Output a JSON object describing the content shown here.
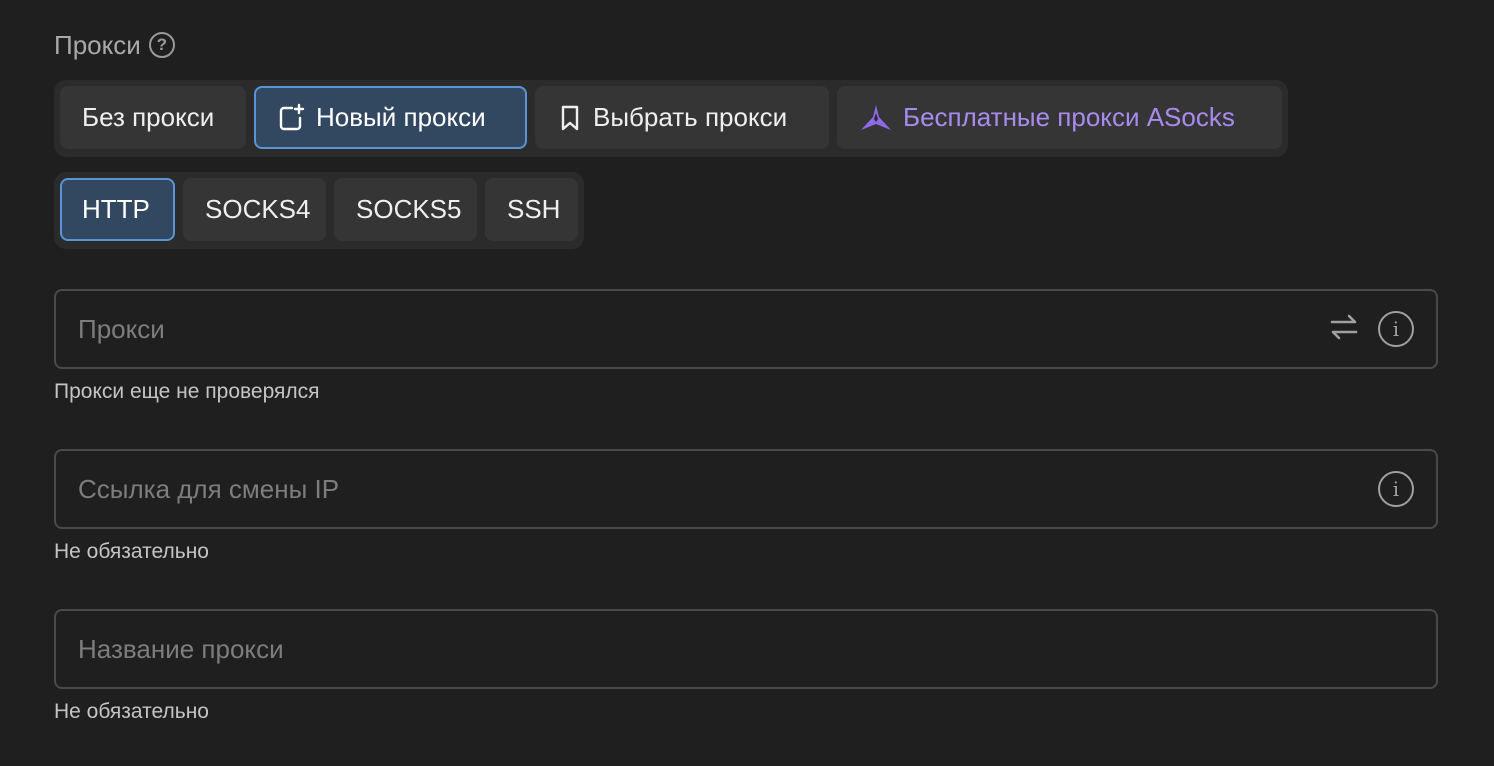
{
  "section": {
    "title": "Прокси"
  },
  "source_tabs": [
    {
      "label": "Без прокси"
    },
    {
      "label": "Новый прокси",
      "active": true
    },
    {
      "label": "Выбрать прокси"
    },
    {
      "label": "Бесплатные прокси ASocks"
    }
  ],
  "type_tabs": [
    {
      "label": "HTTP",
      "active": true
    },
    {
      "label": "SOCKS4"
    },
    {
      "label": "SOCKS5"
    },
    {
      "label": "SSH"
    }
  ],
  "fields": {
    "proxy": {
      "placeholder": "Прокси",
      "value": "",
      "hint": "Прокси еще не проверялся"
    },
    "change_ip_link": {
      "placeholder": "Ссылка для смены IP",
      "value": "",
      "hint": "Не обязательно"
    },
    "proxy_name": {
      "placeholder": "Название прокси",
      "value": "",
      "hint": "Не обязательно"
    }
  },
  "icons": {
    "help": "question-circle-icon",
    "new_proxy": "new-window-plus-icon",
    "select_proxy": "bookmark-icon",
    "asocks": "asocks-logo-icon",
    "swap": "swap-arrows-icon",
    "info": "info-circle-icon"
  },
  "colors": {
    "background": "#1f1f1f",
    "active_tab_bg": "#324760",
    "active_tab_border": "#5a94d6",
    "asocks_accent": "#a98bf0"
  }
}
